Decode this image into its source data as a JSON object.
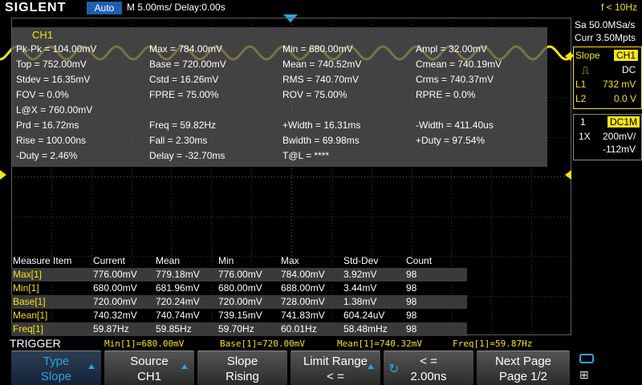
{
  "header": {
    "logo": "SIGLENT",
    "mode": "Auto",
    "timebase": "M 5.00ms/ Delay:0.00s",
    "trigger_freq": "f < 10Hz"
  },
  "measure_panel": {
    "title": "CH1",
    "cells": [
      [
        "Pk-Pk = 104.00mV",
        "Max = 784.00mV",
        "Min = 680.00mV",
        "Ampl = 32.00mV"
      ],
      [
        "Top = 752.00mV",
        "Base = 720.00mV",
        "Mean = 740.52mV",
        "Cmean = 740.19mV"
      ],
      [
        "Stdev = 16.35mV",
        "Cstd = 16.26mV",
        "RMS = 740.70mV",
        "Crms = 740.37mV"
      ],
      [
        "FOV = 0.0%",
        "FPRE = 75.00%",
        "ROV = 75.00%",
        "RPRE = 0.0%"
      ],
      [
        "L@X = 760.00mV",
        "",
        "",
        ""
      ],
      [
        "Prd = 16.72ms",
        "Freq = 59.82Hz",
        "+Width = 16.31ms",
        "-Width = 411.40us"
      ],
      [
        "Rise = 100.00ns",
        "Fall = 2.30ms",
        "Bwidth = 69.98ms",
        "+Duty = 97.54%"
      ],
      [
        "-Duty = 2.46%",
        "Delay = -32.70ms",
        "T@L = ****",
        ""
      ]
    ]
  },
  "stats": {
    "headers": [
      "Measure Item",
      "Current",
      "Mean",
      "Min",
      "Max",
      "Std-Dev",
      "Count"
    ],
    "rows": [
      [
        "Max[1]",
        "776.00mV",
        "779.18mV",
        "776.00mV",
        "784.00mV",
        "3.92mV",
        "98"
      ],
      [
        "Min[1]",
        "680.00mV",
        "681.96mV",
        "680.00mV",
        "688.00mV",
        "3.44mV",
        "98"
      ],
      [
        "Base[1]",
        "720.00mV",
        "720.24mV",
        "720.00mV",
        "728.00mV",
        "1.38mV",
        "98"
      ],
      [
        "Mean[1]",
        "740.32mV",
        "740.74mV",
        "739.15mV",
        "741.83mV",
        "604.24uV",
        "98"
      ],
      [
        "Freq[1]",
        "59.87Hz",
        "59.85Hz",
        "59.70Hz",
        "60.01Hz",
        "58.48mHz",
        "98"
      ]
    ]
  },
  "status_line": {
    "menu_title": "TRIGGER",
    "items": [
      "Min[1]=680.00mV",
      "Base[1]=720.00mV",
      "Mean[1]=740.32mV",
      "Freq[1]=59.87Hz"
    ]
  },
  "menu": [
    {
      "l1": "Type",
      "l2": "Slope"
    },
    {
      "l1": "Source",
      "l2": "CH1"
    },
    {
      "l1": "Slope",
      "l2": "Rising"
    },
    {
      "l1": "Limit Range",
      "l2": "< ="
    },
    {
      "l1": "< =",
      "l2": "2.00ns"
    },
    {
      "l1": "Next Page",
      "l2": "Page 1/2"
    }
  ],
  "right_panel": {
    "sample_rate": "Sa 50.0MSa/s",
    "memory": "Curr 3.50Mpts",
    "slope_label": "Slope",
    "slope_source": "CH1",
    "coupling": "DC",
    "l1_label": "L1",
    "l1_value": "732 mV",
    "l2_label": "L2",
    "l2_value": "0.0 V",
    "ch_num": "1",
    "ch_coupling": "DC1M",
    "probe": "1X",
    "vdiv": "200mV/",
    "offset": "-112mV"
  },
  "colors": {
    "ch1": "#f5e21a",
    "accent": "#2aa4e0",
    "background": "#000000"
  }
}
